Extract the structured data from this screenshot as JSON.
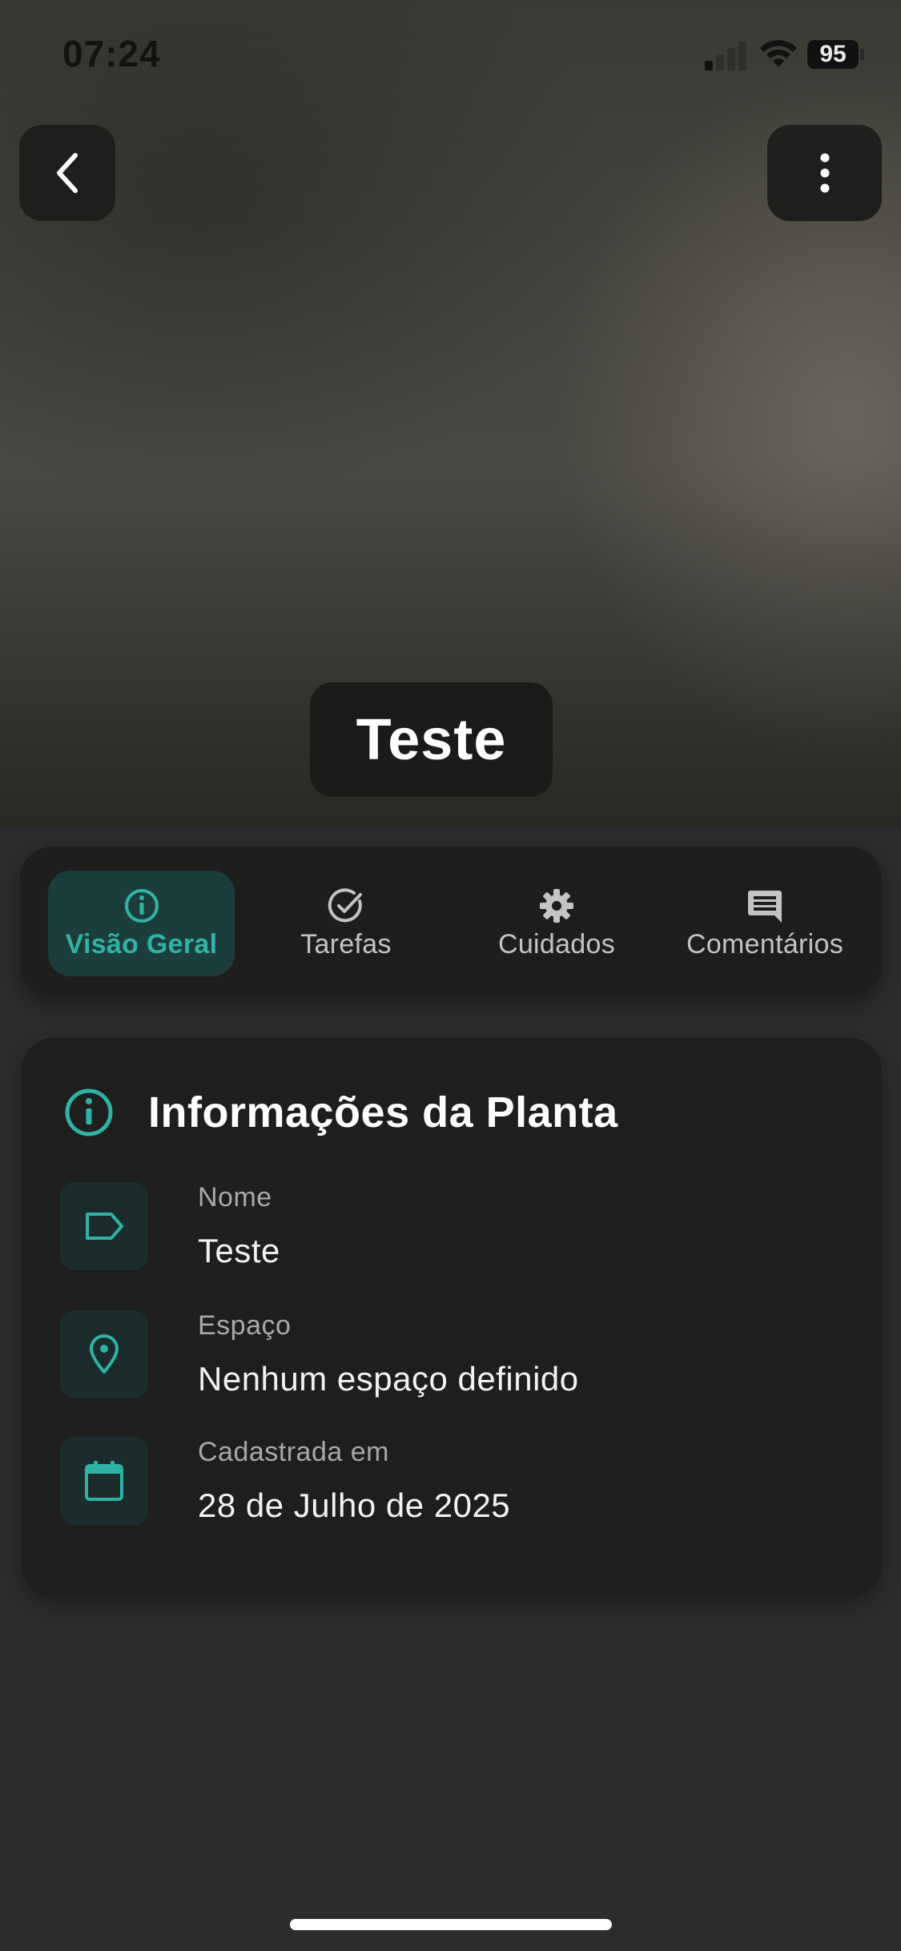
{
  "status_bar": {
    "time": "07:24",
    "battery": "95"
  },
  "plant": {
    "name": "Teste"
  },
  "tabs": [
    {
      "label": "Visão Geral",
      "icon": "info-circle-icon",
      "active": true
    },
    {
      "label": "Tarefas",
      "icon": "check-circle-icon",
      "active": false
    },
    {
      "label": "Cuidados",
      "icon": "gear-icon",
      "active": false
    },
    {
      "label": "Comentários",
      "icon": "comment-icon",
      "active": false
    }
  ],
  "info_card": {
    "title": "Informações da Planta",
    "rows": [
      {
        "label": "Nome",
        "value": "Teste",
        "icon": "tag-icon"
      },
      {
        "label": "Espaço",
        "value": "Nenhum espaço definido",
        "icon": "location-pin-icon"
      },
      {
        "label": "Cadastrada em",
        "value": "28 de Julho de 2025",
        "icon": "calendar-icon"
      }
    ]
  },
  "colors": {
    "accent": "#2fb3a6",
    "active_tab_bg": "#1b3d3b",
    "card_bg": "#1e1e1e",
    "page_bg": "#2c2c2e"
  }
}
